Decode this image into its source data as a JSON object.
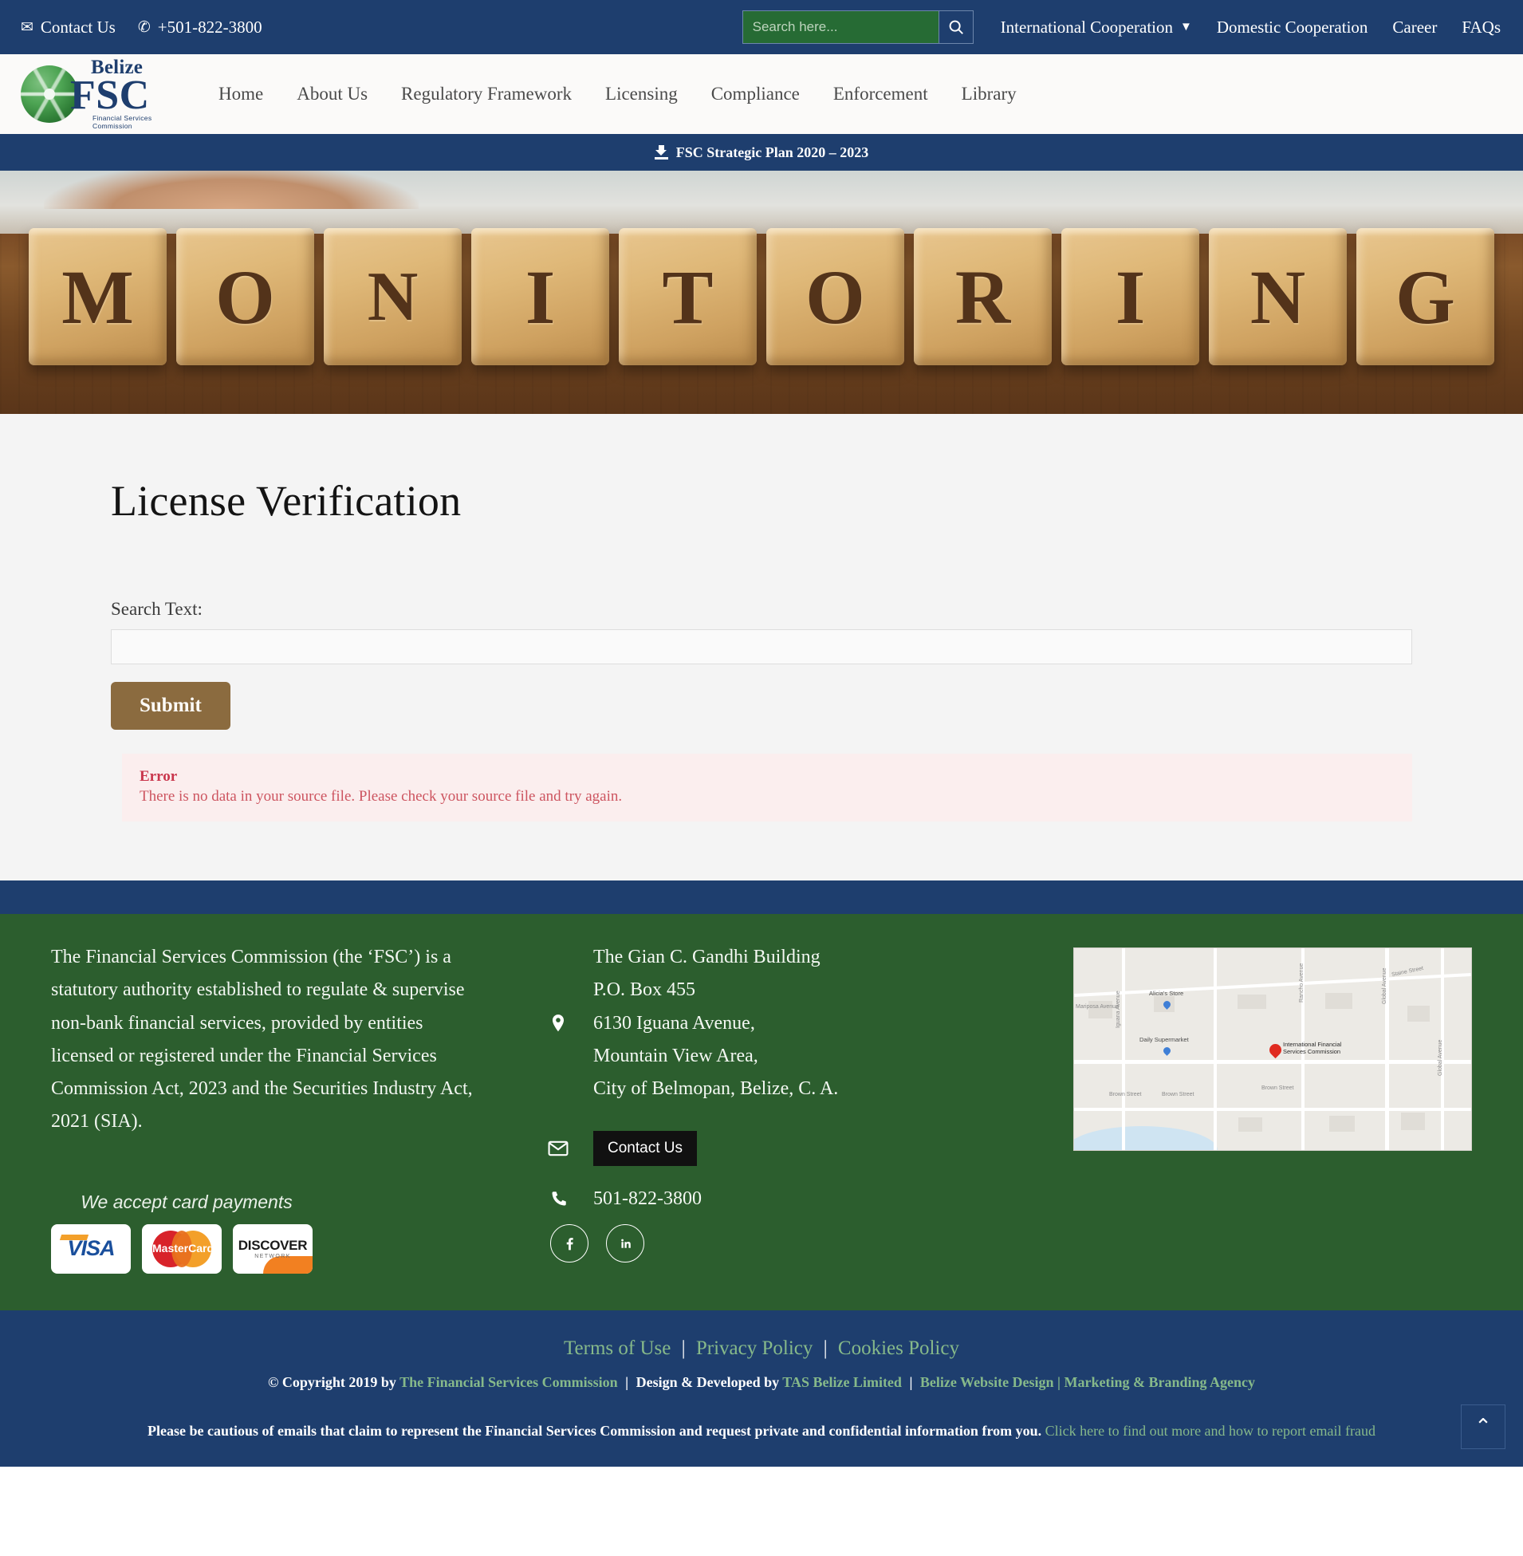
{
  "topbar": {
    "contact_label": "Contact Us",
    "phone_label": "+501-822-3800",
    "search_placeholder": "Search here...",
    "search_value": "",
    "links": [
      {
        "label": "International Cooperation",
        "has_caret": true
      },
      {
        "label": "Domestic Cooperation",
        "has_caret": false
      },
      {
        "label": "Career",
        "has_caret": false
      },
      {
        "label": "FAQs",
        "has_caret": false
      }
    ]
  },
  "logo": {
    "belize": "Belize",
    "fsc": "FSC",
    "subtitle": "Financial Services Commission"
  },
  "nav": {
    "items": [
      {
        "label": "Home"
      },
      {
        "label": "About Us"
      },
      {
        "label": "Regulatory Framework"
      },
      {
        "label": "Licensing"
      },
      {
        "label": "Compliance"
      },
      {
        "label": "Enforcement"
      },
      {
        "label": "Library"
      }
    ]
  },
  "strip": {
    "label": "FSC Strategic Plan 2020 – 2023"
  },
  "hero": {
    "letters": [
      "M",
      "O",
      "N",
      "I",
      "T",
      "O",
      "R",
      "I",
      "N",
      "G"
    ]
  },
  "main": {
    "title": "License Verification",
    "search_label": "Search Text:",
    "search_value": "",
    "submit_label": "Submit",
    "error_title": "Error",
    "error_message": "There is no data in your source file. Please check your source file and try again."
  },
  "footer": {
    "about": "The Financial Services Commission (the ‘FSC’) is a statutory authority established to regulate & supervise non-bank financial services, provided by entities licensed or registered under the Financial Services Commission Act, 2023 and the Securities Industry Act, 2021 (SIA).",
    "payments_title": "We accept card payments",
    "cards": [
      {
        "name": "VISA"
      },
      {
        "name": "MasterCard"
      },
      {
        "name": "DISCOVER",
        "sub": "NETWORK"
      }
    ],
    "address_lines": [
      "The Gian C. Gandhi Building",
      "P.O. Box 455",
      "6130 Iguana Avenue,",
      "Mountain View Area,",
      "City of Belmopan, Belize, C. A."
    ],
    "contact_button": "Contact Us",
    "phone": "501-822-3800",
    "social": [
      {
        "name": "facebook"
      },
      {
        "name": "linkedin"
      }
    ],
    "map": {
      "marker_label": "International Financial\nServices Commission",
      "poi_1": "Alicia's Store",
      "poi_2": "Daily Supermarket",
      "streets": [
        "Staine Street",
        "Mariposa Avenue",
        "Iguana Avenue",
        "Rancho Avenue",
        "Global Avenue",
        "Brown Street",
        "Brown Street",
        "Brown Street",
        "Global Avenue"
      ]
    }
  },
  "bottom": {
    "legal": [
      {
        "label": "Terms of Use"
      },
      {
        "label": "Privacy Policy"
      },
      {
        "label": "Cookies Policy"
      }
    ],
    "copyright_prefix": "© Copyright 2019 by",
    "copyright_org": "The Financial Services Commission",
    "design_prefix": "Design & Developed by",
    "design_company": "TAS Belize Limited",
    "design_extra": "Belize Website Design | Marketing & Branding Agency",
    "fraud_text": "Please be cautious of emails that claim to represent the Financial Services Commission and request private and confidential information from you.",
    "fraud_link": "Click here to find out more and how to report email fraud",
    "to_top": "^"
  }
}
